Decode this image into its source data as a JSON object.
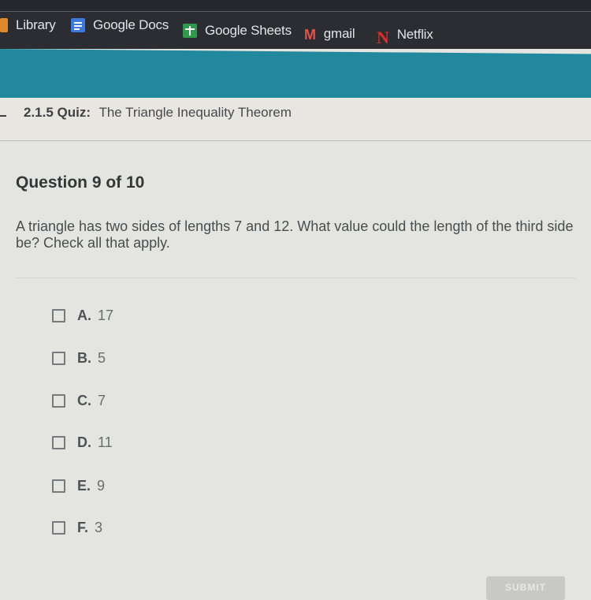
{
  "bookmarks": [
    {
      "label": "Library",
      "icon": "library-icon"
    },
    {
      "label": "Google Docs",
      "icon": "google-docs-icon"
    },
    {
      "label": "Google Sheets",
      "icon": "google-sheets-icon"
    },
    {
      "label": "gmail",
      "icon": "gmail-icon",
      "glyph": "M"
    },
    {
      "label": "Netflix",
      "icon": "netflix-icon",
      "glyph": "N"
    }
  ],
  "quiz": {
    "number": "2.1.5",
    "label": "Quiz:",
    "title": "The Triangle Inequality Theorem"
  },
  "question": {
    "heading": "Question 9 of 10",
    "text": "A triangle has two sides of lengths 7 and 12. What value could the length of the third side be? Check all that apply.",
    "options": [
      {
        "letter": "A.",
        "value": "17",
        "checked": false
      },
      {
        "letter": "B.",
        "value": "5",
        "checked": false
      },
      {
        "letter": "C.",
        "value": "7",
        "checked": false
      },
      {
        "letter": "D.",
        "value": "11",
        "checked": false
      },
      {
        "letter": "E.",
        "value": "9",
        "checked": false
      },
      {
        "letter": "F.",
        "value": "3",
        "checked": false
      }
    ]
  },
  "submit_label": "SUBMIT",
  "colors": {
    "header_teal": "#22889e",
    "bookmarks_bg": "#2b2d33"
  }
}
